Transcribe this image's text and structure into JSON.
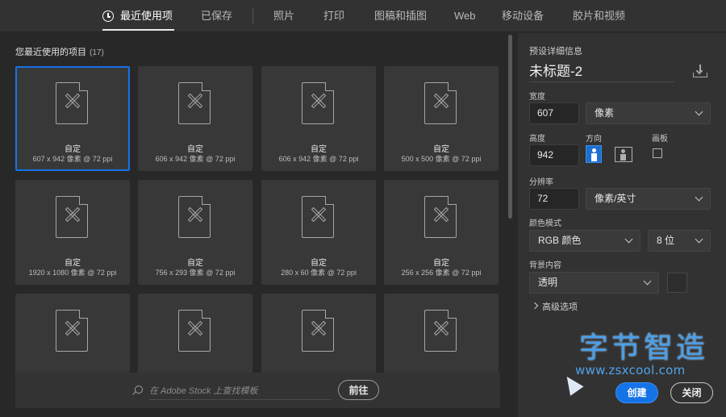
{
  "tabs": [
    {
      "label": "最近使用项",
      "active": true
    },
    {
      "label": "已保存"
    },
    {
      "label": "照片"
    },
    {
      "label": "打印"
    },
    {
      "label": "图稿和插图"
    },
    {
      "label": "Web"
    },
    {
      "label": "移动设备"
    },
    {
      "label": "胶片和视频"
    }
  ],
  "recent": {
    "title": "您最近使用的项目",
    "count": "(17)",
    "items": [
      {
        "name": "自定",
        "dims": "607 x 942 像素 @ 72 ppi",
        "selected": true
      },
      {
        "name": "自定",
        "dims": "606 x 942 像素 @ 72 ppi"
      },
      {
        "name": "自定",
        "dims": "606 x 942 像素 @ 72 ppi"
      },
      {
        "name": "自定",
        "dims": "500 x 500 像素 @ 72 ppi"
      },
      {
        "name": "自定",
        "dims": "1920 x 1080 像素 @ 72 ppi"
      },
      {
        "name": "自定",
        "dims": "756 x 293 像素 @ 72 ppi"
      },
      {
        "name": "自定",
        "dims": "280 x 60 像素 @ 72 ppi"
      },
      {
        "name": "自定",
        "dims": "256 x 256 像素 @ 72 ppi"
      },
      {
        "name": "",
        "dims": ""
      },
      {
        "name": "",
        "dims": ""
      },
      {
        "name": "",
        "dims": ""
      },
      {
        "name": "",
        "dims": ""
      }
    ]
  },
  "search": {
    "placeholder": "在 Adobe Stock 上查找模板",
    "go_label": "前往"
  },
  "preset": {
    "panel_title": "预设详细信息",
    "doc_name": "未标题-2",
    "width_label": "宽度",
    "width_value": "607",
    "width_unit": "像素",
    "height_label": "高度",
    "height_value": "942",
    "orientation_label": "方向",
    "artboard_label": "画板",
    "resolution_label": "分辨率",
    "resolution_value": "72",
    "resolution_unit": "像素/英寸",
    "color_mode_label": "颜色模式",
    "color_mode_value": "RGB 颜色",
    "bit_depth_value": "8 位",
    "background_label": "背景内容",
    "background_value": "透明",
    "advanced_label": "高级选项",
    "create_label": "创建",
    "close_label": "关闭"
  },
  "watermark": {
    "title": "字节智造",
    "url": "www.zsxcool.com"
  },
  "colors": {
    "accent": "#1473e6",
    "background": "#282828",
    "panel": "#323232",
    "watermark": "#4a9fe8"
  }
}
